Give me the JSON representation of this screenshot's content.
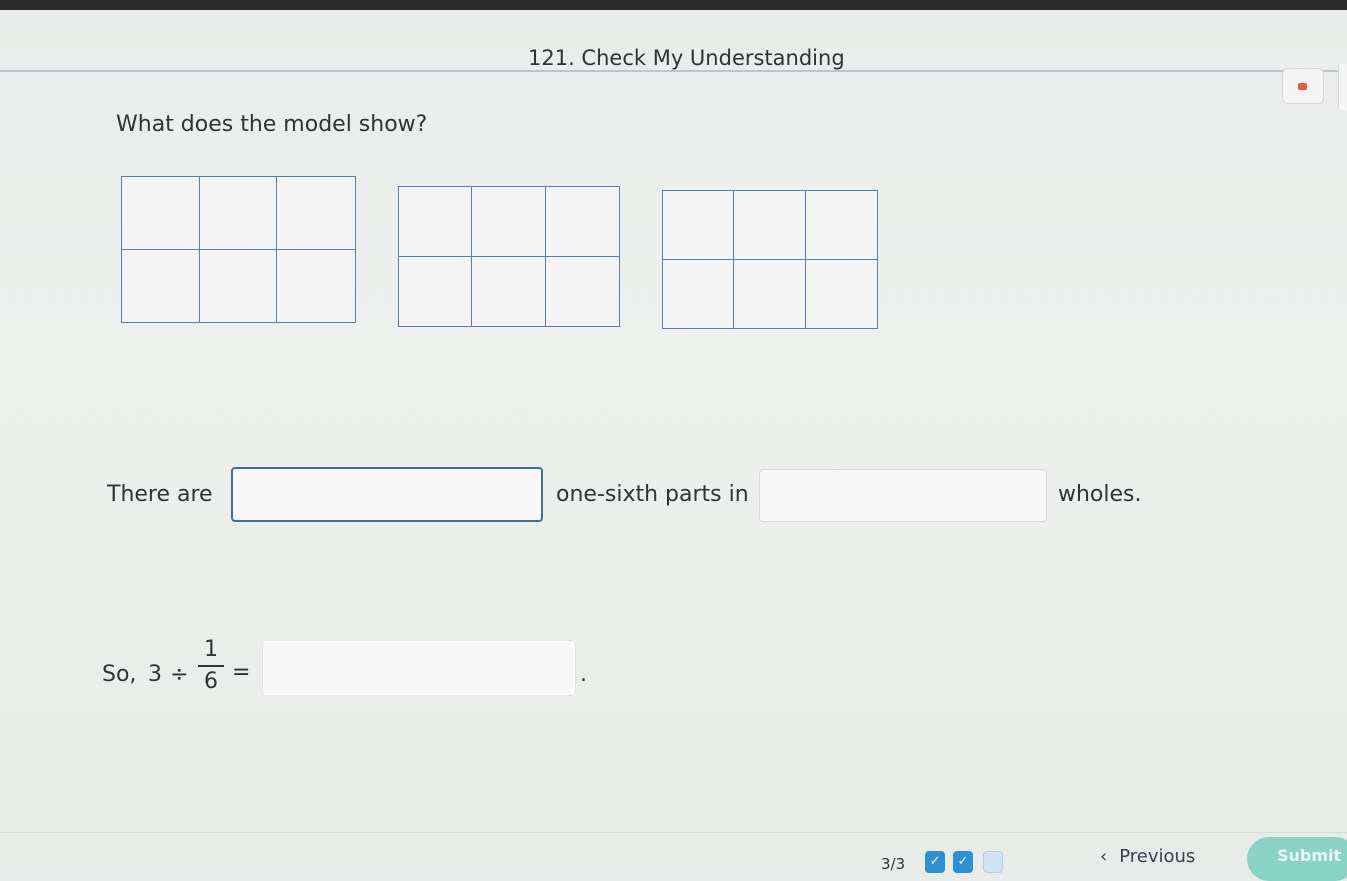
{
  "header": {
    "title": "121. Check My Understanding"
  },
  "question": {
    "prompt": "What does the model show?"
  },
  "models": [
    {
      "rows": 2,
      "cols": 3
    },
    {
      "rows": 2,
      "cols": 3
    },
    {
      "rows": 2,
      "cols": 3
    }
  ],
  "sentence1": {
    "before": "There are",
    "middle": "one-sixth parts in",
    "after": "wholes.",
    "blank1_value": "",
    "blank2_value": ""
  },
  "sentence2": {
    "prefix": "So,",
    "whole": "3",
    "operator": "÷",
    "numerator": "1",
    "denominator": "6",
    "equals": "=",
    "answer_value": "",
    "period": "."
  },
  "footer": {
    "progress_text": "3/3",
    "progress_items": [
      {
        "state": "done",
        "icon": "check-icon",
        "glyph": "✓"
      },
      {
        "state": "done",
        "icon": "check-icon",
        "glyph": "✓"
      },
      {
        "state": "open"
      }
    ],
    "previous_label": "Previous",
    "previous_icon": "‹",
    "submit_label": "Submit"
  },
  "colors": {
    "grid_line": "#5b7ea8",
    "active_input_border": "#3d6f9a",
    "submit_bg": "#8ad2c3",
    "progress_done": "#2d8fd5"
  }
}
